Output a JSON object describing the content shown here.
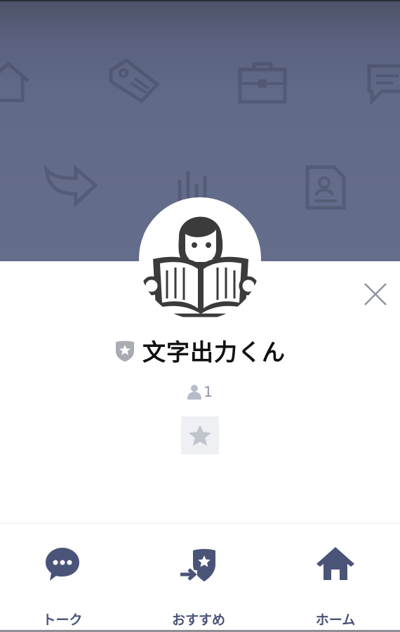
{
  "profile": {
    "name": "文字出力くん",
    "friend_count": "1",
    "badge_icon": "official-shield-icon"
  },
  "bottom_nav": {
    "items": [
      {
        "label": "トーク",
        "icon": "chat-bubble-icon"
      },
      {
        "label": "おすすめ",
        "icon": "recommend-shield-icon"
      },
      {
        "label": "ホーム",
        "icon": "home-icon"
      }
    ]
  },
  "colors": {
    "banner": "#656d8c",
    "nav_accent": "#4a5478",
    "badge_gray": "#a9acb3",
    "favorite_bg": "#eef0f3"
  }
}
